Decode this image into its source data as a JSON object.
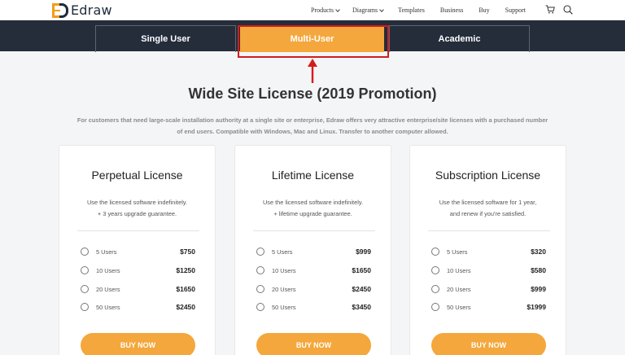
{
  "brand": {
    "logo_text": "Edraw"
  },
  "nav": {
    "items": [
      {
        "label": "Products",
        "dropdown": true
      },
      {
        "label": "Diagrams",
        "dropdown": true
      },
      {
        "label": "Templates",
        "dropdown": false
      },
      {
        "label": "Business",
        "dropdown": false
      },
      {
        "label": "Buy",
        "dropdown": false
      },
      {
        "label": "Support",
        "dropdown": false
      }
    ]
  },
  "tabs": [
    {
      "label": "Single User",
      "active": false
    },
    {
      "label": "Multi-User",
      "active": true
    },
    {
      "label": "Academic",
      "active": false
    }
  ],
  "heading": "Wide Site License (2019 Promotion)",
  "description_lines": [
    "For customers that need large-scale installation authority at a single site or enterprise, Edraw offers very attractive enterprise/site licenses with a purchased number",
    "of end users. Compatible with Windows, Mac and Linux. Transfer to another computer allowed."
  ],
  "cards": [
    {
      "title": "Perpetual License",
      "sub": [
        "Use the licensed software indefinitely.",
        "+ 3 years upgrade guarantee."
      ],
      "options": [
        {
          "label": "5 Users",
          "price": "$750"
        },
        {
          "label": "10 Users",
          "price": "$1250"
        },
        {
          "label": "20 Users",
          "price": "$1650"
        },
        {
          "label": "50 Users",
          "price": "$2450"
        }
      ],
      "button": "BUY NOW"
    },
    {
      "title": "Lifetime License",
      "sub": [
        "Use the licensed software indefinitely.",
        "+ lifetime upgrade guarantee."
      ],
      "options": [
        {
          "label": "5 Users",
          "price": "$999"
        },
        {
          "label": "10 Users",
          "price": "$1650"
        },
        {
          "label": "20 Users",
          "price": "$2450"
        },
        {
          "label": "50 Users",
          "price": "$3450"
        }
      ],
      "button": "BUY NOW"
    },
    {
      "title": "Subscription License",
      "sub": [
        "Use the licensed software for 1 year,",
        "and renew if you're satisfied."
      ],
      "options": [
        {
          "label": "5 Users",
          "price": "$320"
        },
        {
          "label": "10 Users",
          "price": "$580"
        },
        {
          "label": "20 Users",
          "price": "$999"
        },
        {
          "label": "50 Users",
          "price": "$1999"
        }
      ],
      "button": "BUY NOW"
    }
  ],
  "colors": {
    "accent": "#f4a73c",
    "tabbar": "#252d3b",
    "annotation": "#d41c1c"
  },
  "icons": {
    "cart": "shopping-cart-icon",
    "search": "search-icon",
    "annotation_arrow": "arrow-up-icon"
  }
}
